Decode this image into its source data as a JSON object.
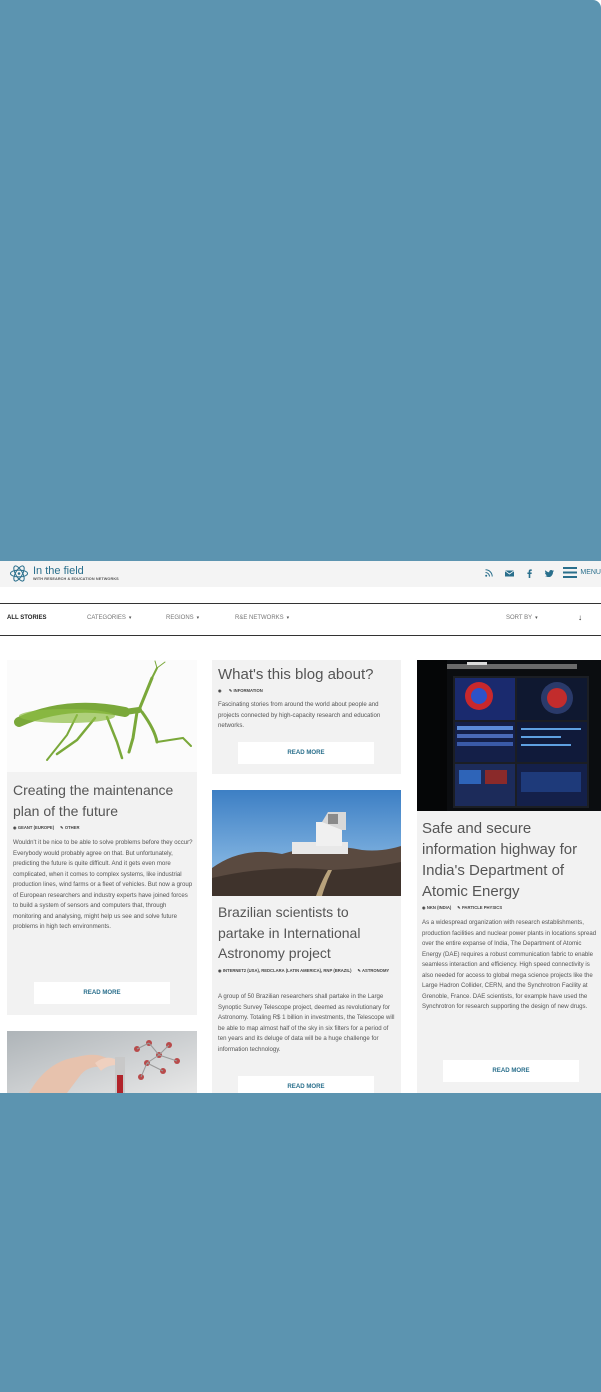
{
  "header": {
    "logo_title": "In the field",
    "logo_subtitle": "WITH RESEARCH & EDUCATION NETWORKS",
    "menu_label": "MENU",
    "icons": [
      "rss-icon",
      "mail-icon",
      "facebook-icon",
      "twitter-icon",
      "hamburger-icon"
    ]
  },
  "filters": {
    "all_stories": "ALL STORIES",
    "categories": "CATEGORIES",
    "regions": "REGIONS",
    "rse_networks": "R&E NETWORKS",
    "sort_by": "SORT BY",
    "caret": "▾",
    "arrow": "↓"
  },
  "cards": {
    "mantis": {
      "title": "Creating the maintenance plan of the future",
      "meta": [
        "GEANT (EUROPE)",
        "OTHER"
      ],
      "excerpt": "Wouldn't it be nice to be able to solve problems before they occur? Everybody would probably agree on that. But unfortunately, predicting the future is quite difficult. And it gets even more complicated, when it comes to complex systems, like industrial production lines, wind farms or a fleet of vehicles. But now a group of European researchers and industry experts have joined forces to build a system of sensors and computers that, through monitoring and analysing, might help us see and solve future problems in high tech environments.",
      "button": "READ MORE"
    },
    "blog": {
      "title": "What's this blog about?",
      "meta": [
        "",
        "INFORMATION"
      ],
      "excerpt": "Fascinating stories from around the world about people and projects connected by high-capacity research and education networks.",
      "button": "READ MORE"
    },
    "brazil": {
      "title": "Brazilian scientists to partake in International Astronomy project",
      "meta": [
        "INTERNET2 (USA), REDCLARA (LATIN AMERICA), RNP (BRAZIL)",
        "ASTRONOMY"
      ],
      "excerpt": "A group of 50 Brazilian researchers shall partake in the Large Synoptic Survey Telescope project, deemed as revolutionary for Astronomy. Totaling R$ 1 billion in investments, the Telescope will be able to map almost half of the sky in six filters for a period of ten years and its deluge of data will be a huge challenge for information technology.",
      "button": "READ MORE"
    },
    "india": {
      "title": "Safe and secure information highway for India's Department of Atomic Energy",
      "meta": [
        "NKN (INDIA)",
        "PARTICLE PHYSICS"
      ],
      "excerpt": "As a widespread organization with research establishments, production facilities and nuclear power plants in locations spread over the entire expanse of India, The Department of Atomic Energy (DAE) requires a robust communication fabric to enable seamless interaction and efficiency. High speed connectivity is also needed for access to global mega science projects like the Large Hadron Collider, CERN, and the Synchrotron Facility at Grenoble, France. DAE scientists, for example have used the Synchrotron for research supporting the design of new drugs.",
      "button": "READ MORE"
    }
  }
}
